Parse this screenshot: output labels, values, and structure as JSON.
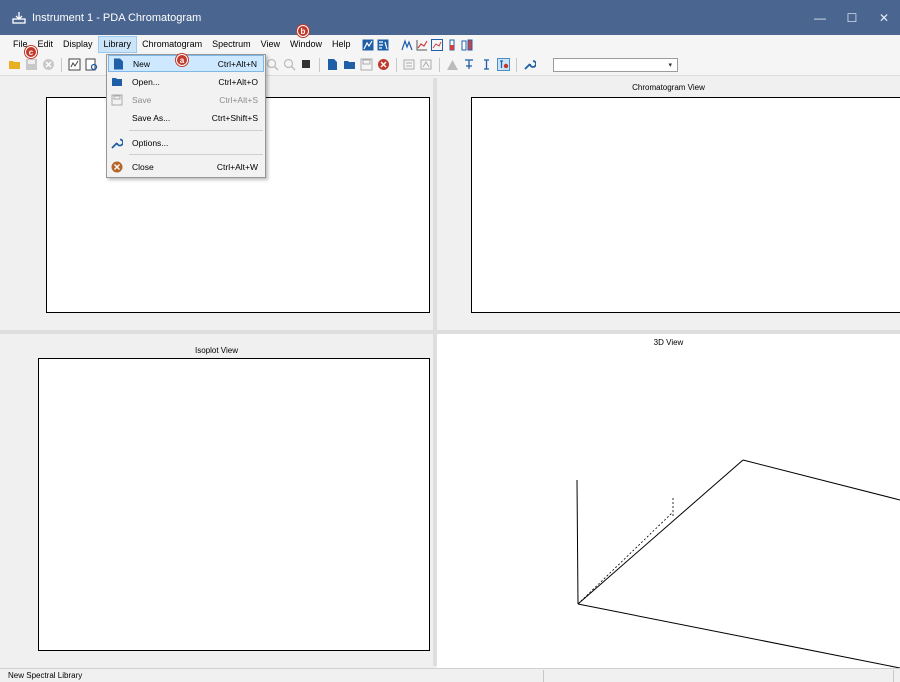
{
  "window": {
    "title": "Instrument 1 - PDA Chromatogram",
    "controls": {
      "minimize": "—",
      "maximize": "☐",
      "close": "✕"
    }
  },
  "menubar": {
    "items": [
      "File",
      "Edit",
      "Display",
      "Library",
      "Chromatogram",
      "Spectrum",
      "View",
      "Window",
      "Help"
    ],
    "active": "Library"
  },
  "library_menu": {
    "items": [
      {
        "label": "New",
        "shortcut": "Ctrl+Alt+N",
        "icon": "new-document-icon",
        "state": "highlighted"
      },
      {
        "label": "Open...",
        "shortcut": "Ctrl+Alt+O",
        "icon": "open-folder-icon",
        "state": "normal"
      },
      {
        "label": "Save",
        "shortcut": "Ctrl+Alt+S",
        "icon": "save-disk-icon",
        "state": "disabled"
      },
      {
        "label": "Save As...",
        "shortcut": "Ctrt+Shift+S",
        "icon": "",
        "state": "normal"
      },
      {
        "label": "Options...",
        "shortcut": "",
        "icon": "wrench-icon",
        "state": "normal"
      },
      {
        "label": "Close",
        "shortcut": "Ctrl+Alt+W",
        "icon": "close-circle-icon",
        "state": "normal"
      }
    ]
  },
  "callouts": {
    "a": "a",
    "b": "b",
    "c": "c"
  },
  "panes": {
    "chromatogram": {
      "title": "Chromatogram View"
    },
    "isoplot": {
      "title": "Isoplot View"
    },
    "view3d": {
      "title": "3D View"
    }
  },
  "toolbar": {
    "combo_value": ""
  },
  "status": {
    "text": "New Spectral Library"
  },
  "colors": {
    "titlebar": "#4a6590",
    "highlight": "#cde8ff",
    "callout": "#c0392b",
    "folder": "#e8b020",
    "blue_icon": "#1f5fa8"
  }
}
